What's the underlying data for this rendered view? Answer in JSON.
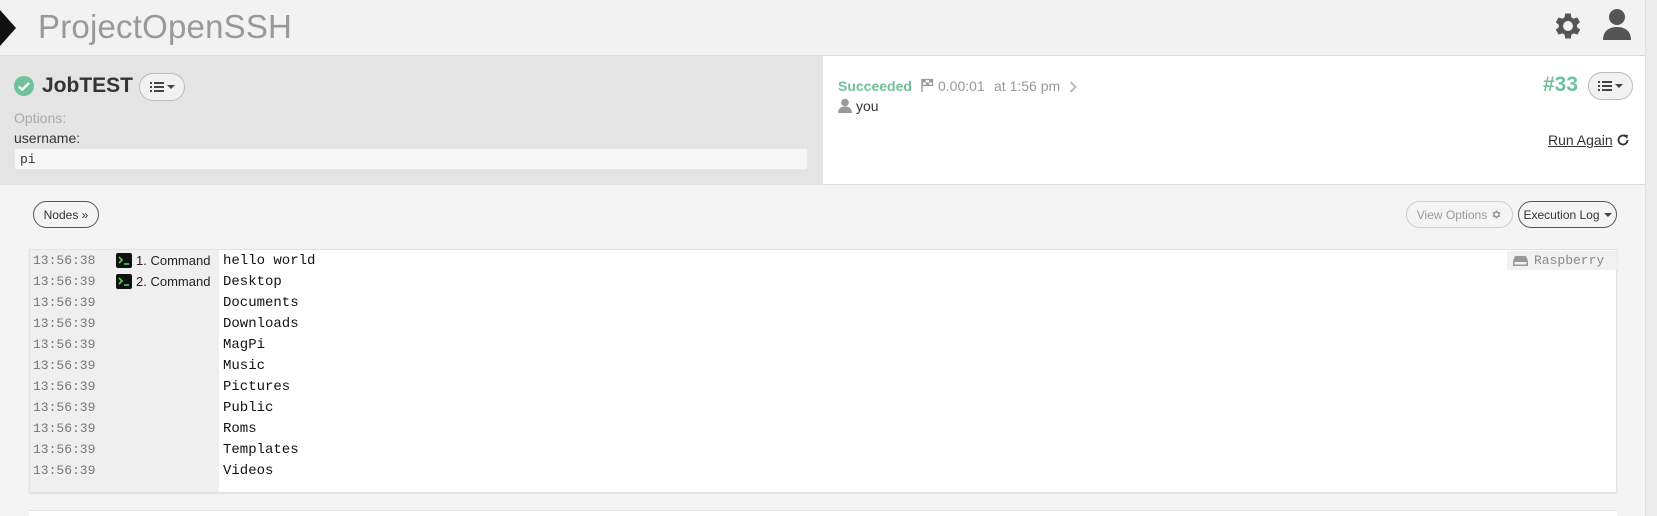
{
  "app": {
    "title": "ProjectOpenSSH"
  },
  "job": {
    "name": "JobTEST",
    "options_label": "Options:",
    "option": {
      "name": "username:",
      "value": "pi"
    }
  },
  "execution": {
    "status": "Succeeded",
    "duration": "0.00:01",
    "time": "at 1:56 pm",
    "user": "you",
    "id": "#33",
    "run_again_label": "Run Again"
  },
  "toolbar": {
    "nodes_label": "Nodes »",
    "view_options_label": "View Options",
    "execution_log_label": "Execution Log"
  },
  "log": {
    "node": "Raspberry",
    "rows": [
      {
        "time": "13:56:38",
        "step": "1. Command",
        "output": "hello world"
      },
      {
        "time": "13:56:39",
        "step": "2. Command",
        "output": "Desktop"
      },
      {
        "time": "13:56:39",
        "step": "",
        "output": "Documents"
      },
      {
        "time": "13:56:39",
        "step": "",
        "output": "Downloads"
      },
      {
        "time": "13:56:39",
        "step": "",
        "output": "MagPi"
      },
      {
        "time": "13:56:39",
        "step": "",
        "output": "Music"
      },
      {
        "time": "13:56:39",
        "step": "",
        "output": "Pictures"
      },
      {
        "time": "13:56:39",
        "step": "",
        "output": "Public"
      },
      {
        "time": "13:56:39",
        "step": "",
        "output": "Roms"
      },
      {
        "time": "13:56:39",
        "step": "",
        "output": "Templates"
      },
      {
        "time": "13:56:39",
        "step": "",
        "output": "Videos"
      }
    ]
  },
  "icons": {
    "nav_toggle": "nav-toggle-icon",
    "settings": "gear-icon",
    "user": "user-icon",
    "status": "check-circle-icon",
    "menu": "list-icon",
    "flag": "flag-icon",
    "chevron": "chevron-right-icon",
    "refresh": "refresh-icon",
    "terminal": "terminal-icon",
    "node": "server-icon"
  },
  "colors": {
    "success": "#6ec29a",
    "brand_text": "#999999",
    "job_panel_bg": "#e4e4e4",
    "page_bg": "#f4f4f4"
  }
}
